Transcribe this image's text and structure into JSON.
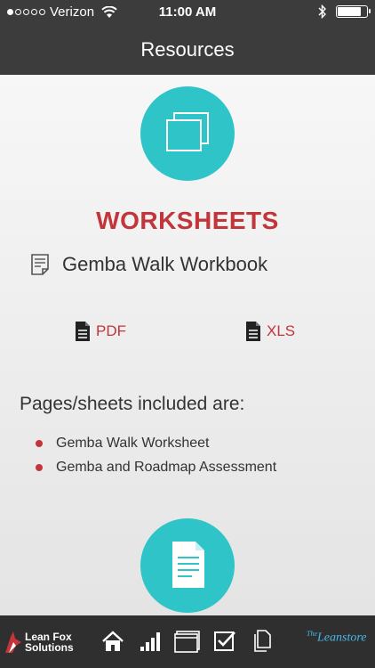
{
  "status_bar": {
    "carrier": "Verizon",
    "time": "11:00 AM",
    "signal_dots_filled": 1,
    "signal_dots_total": 5,
    "battery_level": 0.85
  },
  "nav": {
    "title": "Resources"
  },
  "section": {
    "title": "WORKSHEETS",
    "workbook_title": "Gemba Walk Workbook",
    "downloads": {
      "pdf_label": "PDF",
      "xls_label": "XLS"
    },
    "included_heading": "Pages/sheets included are:",
    "items": [
      "Gemba Walk Worksheet",
      "Gemba and Roadmap Assessment"
    ]
  },
  "tab_bar": {
    "left_brand_line1": "Lean Fox",
    "left_brand_line2": "Solutions",
    "right_brand_prefix": "The",
    "right_brand_name": "Leanstore"
  },
  "colors": {
    "accent_red": "#c2353b",
    "accent_teal": "#2ec4c8",
    "bar_dark": "#3c3c3c"
  },
  "icons": {
    "top_circle": "copy-stack-icon",
    "bottom_circle": "document-icon",
    "workbook": "worksheet-icon",
    "tabs": [
      "home-icon",
      "bar-chart-icon",
      "windows-icon",
      "checkbox-icon",
      "copy-icon"
    ]
  }
}
